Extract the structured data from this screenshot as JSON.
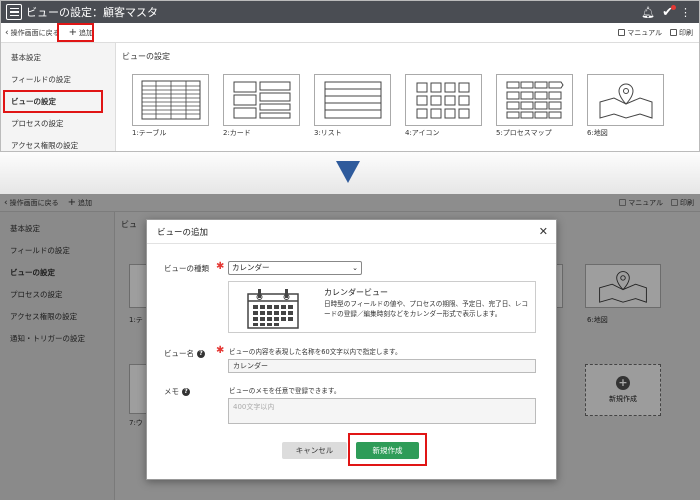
{
  "window": {
    "title": "ビューの設定：顧客マスタ"
  },
  "toolbar": {
    "back_label": "操作画面に戻る",
    "add_label": "追加",
    "manual_label": "マニュアル",
    "print_label": "印刷"
  },
  "sidebar": {
    "items": [
      {
        "label": "基本設定"
      },
      {
        "label": "フィールドの設定"
      },
      {
        "label": "ビューの設定"
      },
      {
        "label": "プロセスの設定"
      },
      {
        "label": "アクセス権限の設定"
      },
      {
        "label": "通知・トリガーの設定"
      }
    ]
  },
  "main": {
    "title": "ビューの設定",
    "views": [
      {
        "label": "1:テーブル",
        "icon": "table-icon"
      },
      {
        "label": "2:カード",
        "icon": "card-icon"
      },
      {
        "label": "3:リスト",
        "icon": "list-icon"
      },
      {
        "label": "4:アイコン",
        "icon": "grid-icon"
      },
      {
        "label": "5:プロセスマップ",
        "icon": "process-map-icon"
      },
      {
        "label": "6:地図",
        "icon": "map-icon"
      }
    ],
    "partial_labels": {
      "title_fragment": "ビュ",
      "table_fragment": "1:テ",
      "seven_fragment": "7:ウ"
    },
    "new_card_label": "新規作成"
  },
  "dialog": {
    "title": "ビューの追加",
    "type_label": "ビューの種類",
    "type_value": "カレンダー",
    "type_desc_title": "カレンダービュー",
    "type_desc_text": "日時型のフィールドの値や、プロセスの期限、予定日、完了日、レコードの登録／編集時刻などをカレンダー形式で表示します。",
    "name_label": "ビュー名",
    "name_hint": "ビューの内容を表現した名称を60文字以内で指定します。",
    "name_value": "カレンダー",
    "memo_label": "メモ",
    "memo_hint": "ビューのメモを任意で登録できます。",
    "memo_placeholder": "400文字以内",
    "cancel_label": "キャンセル",
    "create_label": "新規作成"
  },
  "colors": {
    "titlebar": "#4a4d53",
    "highlight": "#e01515",
    "arrow": "#2f5b9c",
    "create_button": "#2e9c58"
  }
}
